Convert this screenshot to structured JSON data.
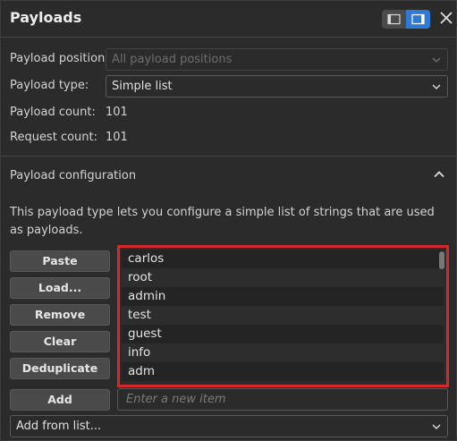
{
  "header": {
    "title": "Payloads"
  },
  "settings": {
    "position_label": "Payload position:",
    "position_value": "All payload positions",
    "type_label": "Payload type:",
    "type_value": "Simple list",
    "count_label": "Payload count:",
    "count_value": "101",
    "request_label": "Request count:",
    "request_value": "101"
  },
  "config": {
    "title": "Payload configuration",
    "description": "This payload type lets you configure a simple list of strings that are used as payloads."
  },
  "buttons": {
    "paste": "Paste",
    "load": "Load...",
    "remove": "Remove",
    "clear": "Clear",
    "deduplicate": "Deduplicate",
    "add": "Add"
  },
  "list": {
    "items": [
      "carlos",
      "root",
      "admin",
      "test",
      "guest",
      "info",
      "adm"
    ]
  },
  "new_item": {
    "placeholder": "Enter a new item"
  },
  "add_from_list": {
    "label": "Add from list..."
  },
  "colors": {
    "accent": "#2f7ad6",
    "highlight": "#d22a2a",
    "background": "#2b2b2b"
  },
  "icons": [
    "layout-left-icon",
    "layout-right-icon",
    "close-icon",
    "chevron-down-icon",
    "chevron-up-icon"
  ]
}
